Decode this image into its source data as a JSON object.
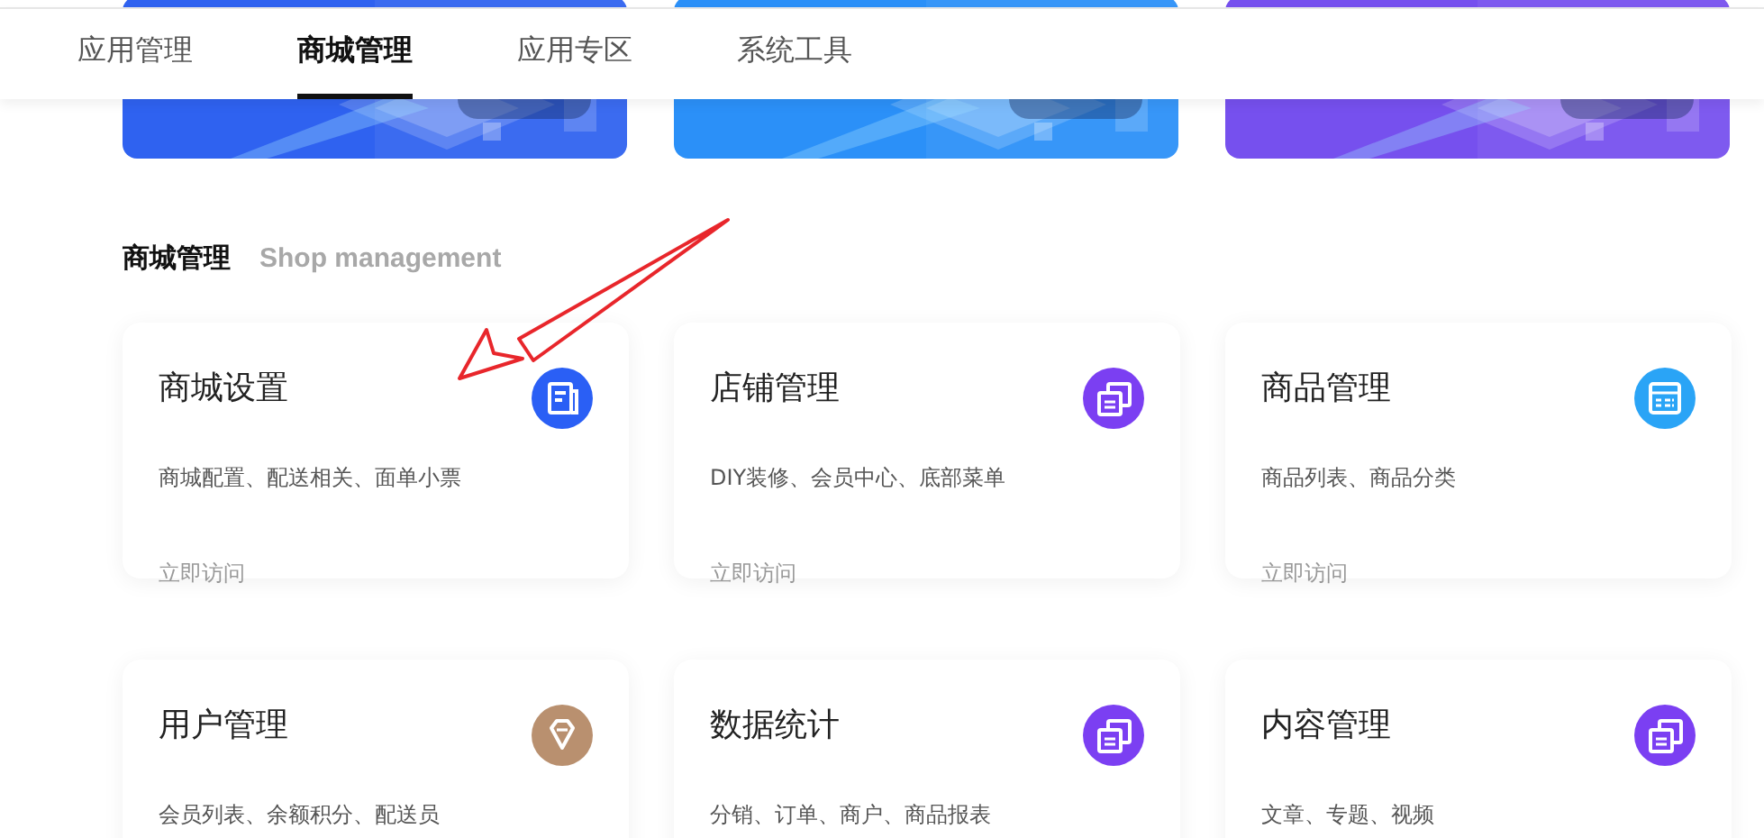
{
  "tabs": [
    {
      "label": "应用管理",
      "selected": false
    },
    {
      "label": "商城管理",
      "selected": true
    },
    {
      "label": "应用专区",
      "selected": false
    },
    {
      "label": "系统工具",
      "selected": false
    }
  ],
  "banners": [
    {
      "color": "#2f62f0"
    },
    {
      "color": "#2b90f8"
    },
    {
      "color": "#7650ee"
    }
  ],
  "section": {
    "title": "商城管理",
    "subtitle": "Shop management"
  },
  "cards": [
    {
      "title": "商城设置",
      "description": "商城配置、配送相关、面单小票",
      "link": "立即访问",
      "kind": "document",
      "color": "#2a5ff5"
    },
    {
      "title": "店铺管理",
      "description": "DIY装修、会员中心、底部菜单",
      "link": "立即访问",
      "kind": "stack",
      "color": "#7b3ff2"
    },
    {
      "title": "商品管理",
      "description": "商品列表、商品分类",
      "link": "立即访问",
      "kind": "table",
      "color": "#2aa4f6"
    },
    {
      "title": "用户管理",
      "description": "会员列表、余额积分、配送员",
      "kind": "gem",
      "color": "#b9906f"
    },
    {
      "title": "数据统计",
      "description": "分销、订单、商户、商品报表",
      "kind": "stack",
      "color": "#7b3ff2"
    },
    {
      "title": "内容管理",
      "description": "文章、专题、视频",
      "kind": "stack",
      "color": "#7b3ff2"
    }
  ]
}
